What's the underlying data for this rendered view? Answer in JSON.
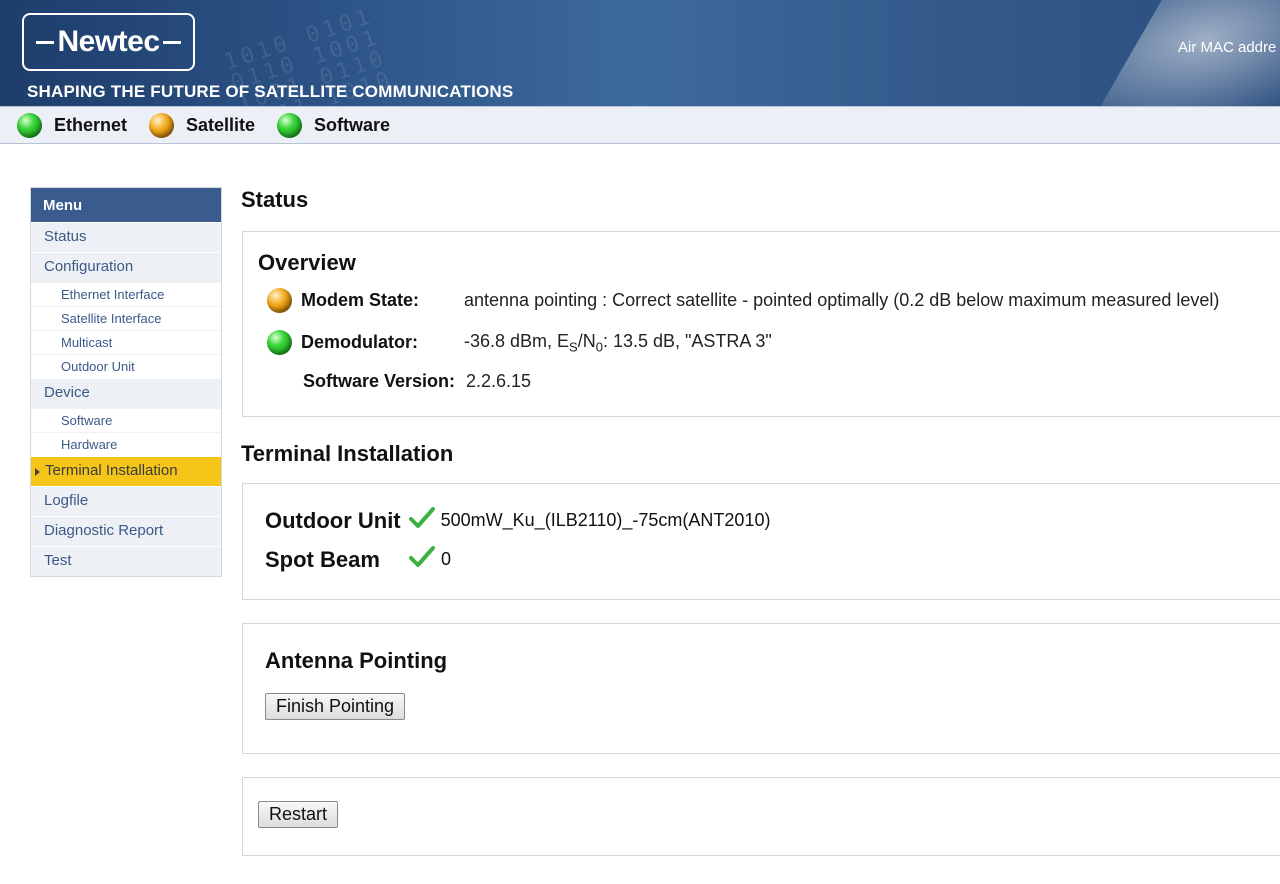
{
  "header": {
    "logo_text": "Newtec",
    "tagline": "SHAPING THE FUTURE OF SATELLITE COMMUNICATIONS",
    "mac_label": "Air MAC addre"
  },
  "status_bar": {
    "items": [
      {
        "label": "Ethernet",
        "state": "green"
      },
      {
        "label": "Satellite",
        "state": "orange"
      },
      {
        "label": "Software",
        "state": "green"
      }
    ]
  },
  "menu": {
    "title": "Menu",
    "items": {
      "status": "Status",
      "configuration": "Configuration",
      "ethernet_interface": "Ethernet Interface",
      "satellite_interface": "Satellite Interface",
      "multicast": "Multicast",
      "outdoor_unit": "Outdoor Unit",
      "device": "Device",
      "software": "Software",
      "hardware": "Hardware",
      "terminal_installation": "Terminal Installation",
      "logfile": "Logfile",
      "diagnostic_report": "Diagnostic Report",
      "test": "Test"
    },
    "active": "Terminal Installation"
  },
  "page": {
    "title": "Status",
    "overview": {
      "title": "Overview",
      "modem_state_label": "Modem State:",
      "modem_state_value": "antenna pointing : Correct satellite - pointed optimally (0.2 dB below maximum measured level)",
      "demodulator_label": "Demodulator:",
      "demodulator_value_prefix": "-36.8 dBm, E",
      "demodulator_sub_s": "S",
      "demodulator_slash": "/N",
      "demodulator_sub_0": "0",
      "demodulator_value_suffix": ": 13.5 dB, \"ASTRA 3\"",
      "software_version_label": "Software Version:",
      "software_version_value": "2.2.6.15"
    },
    "terminal_installation": {
      "title": "Terminal Installation",
      "outdoor_unit_label": "Outdoor Unit",
      "outdoor_unit_value": "500mW_Ku_(ILB2110)_-75cm(ANT2010)",
      "spot_beam_label": "Spot Beam",
      "spot_beam_value": "0"
    },
    "antenna_pointing": {
      "title": "Antenna Pointing",
      "finish_button": "Finish Pointing"
    },
    "restart_button": "Restart"
  },
  "colors": {
    "banner": "#2c5386",
    "menu_header": "#3a5b8d",
    "menu_active": "#f5c518",
    "link": "#3b5a88",
    "led_green": "#3ad43a",
    "led_orange": "#f2a81a",
    "check_green": "#3cb043"
  }
}
